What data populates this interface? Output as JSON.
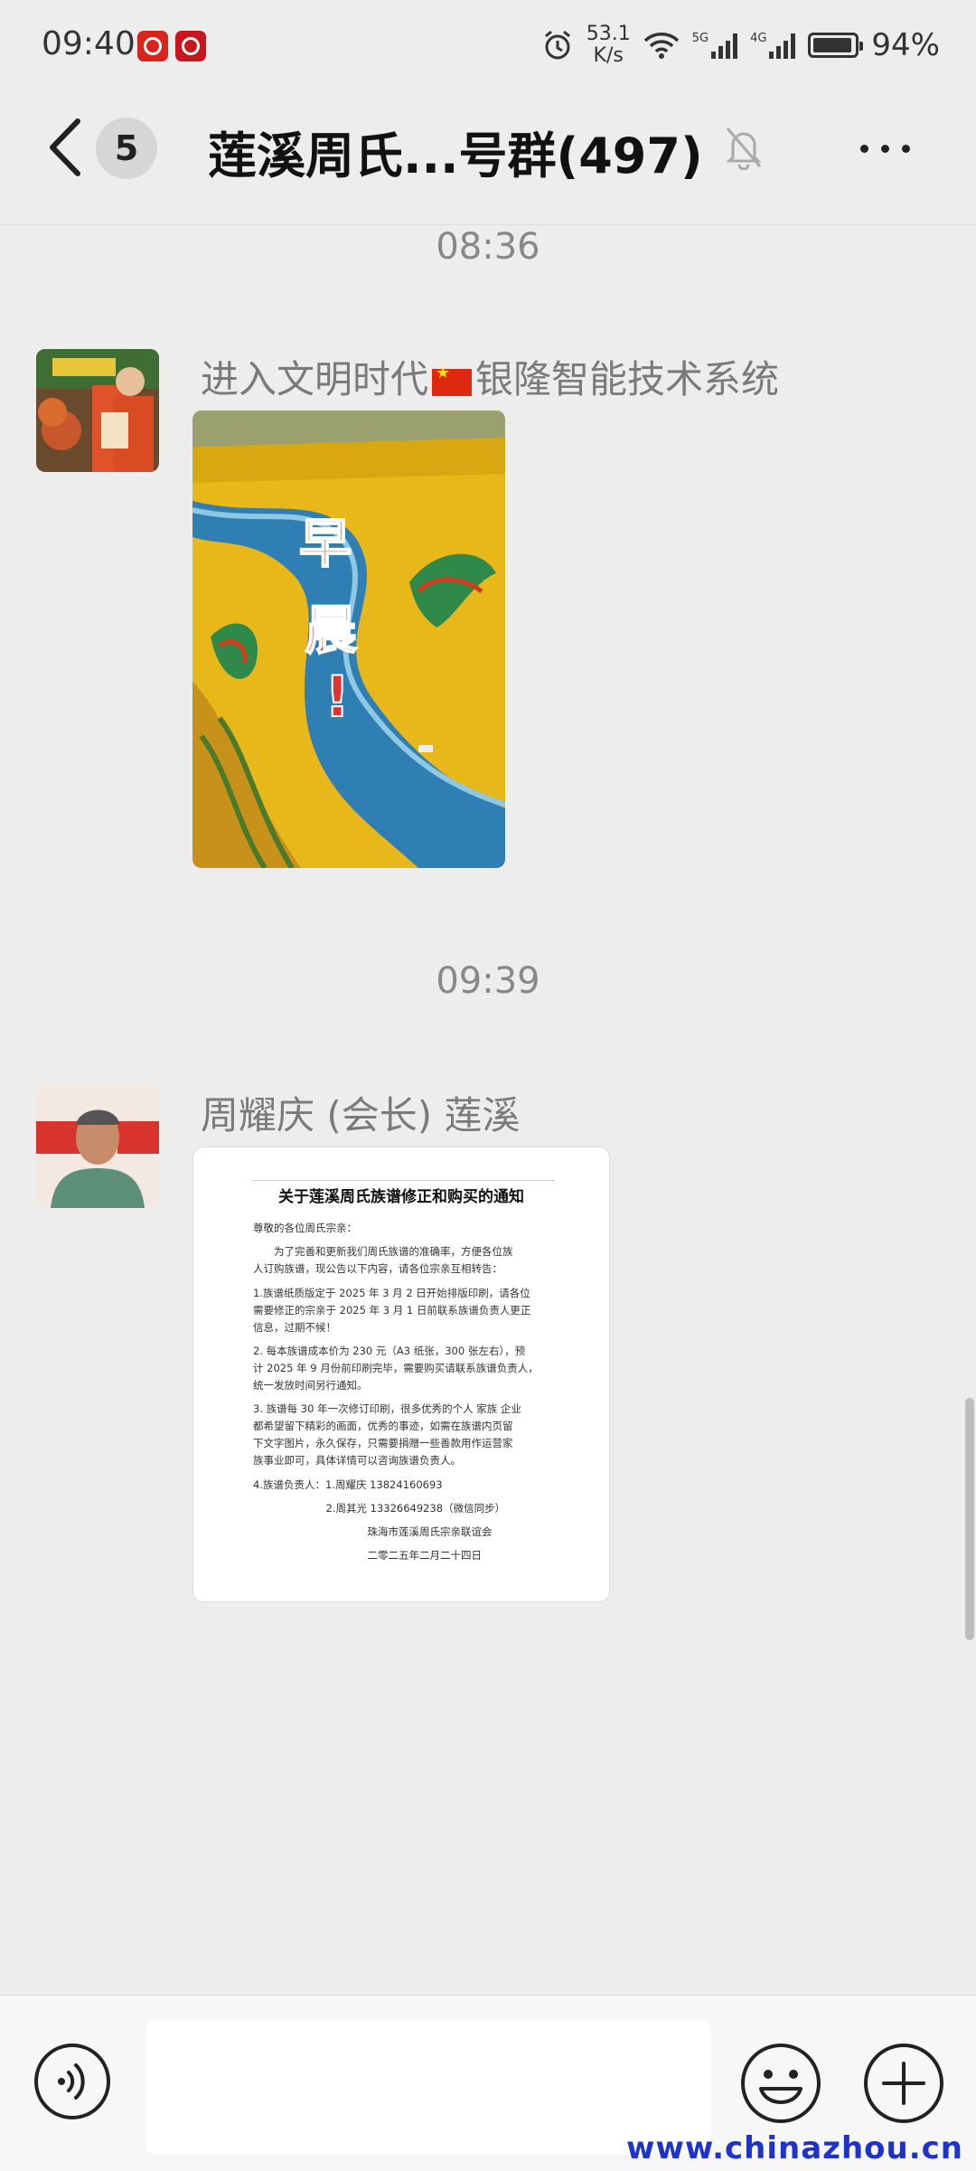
{
  "status_bar": {
    "time": "09:40",
    "net_speed_value": "53.1",
    "net_speed_unit": "K/s",
    "signal_1": "5G",
    "signal_2": "4G",
    "battery": "94%"
  },
  "header": {
    "unread_count": "5",
    "title": "莲溪周氏...号群(497)"
  },
  "messages": [
    {
      "time": "08:36",
      "sender_prefix": "进入文明时代",
      "sender_suffix": "银隆智能技术系统",
      "image_text": [
        "早",
        "晨",
        "!"
      ]
    },
    {
      "time": "09:39",
      "sender": "周耀庆 (会长) 莲溪",
      "document": {
        "title": "关于莲溪周氏族谱修正和购买的通知",
        "lines": [
          "尊敬的各位周氏宗亲：",
          "　　为了完善和更新我们周氏族谱的准确率，方便各位族",
          "人订购族谱，现公告以下内容，请各位宗亲互相转告：",
          "1.族谱纸质版定于 2025 年 3 月 2 日开始排版印刷，请各位",
          "需要修正的宗亲于 2025 年 3 月 1 日前联系族谱负责人更正",
          "信息，过期不候！",
          "2. 每本族谱成本价为 230 元（A3 纸张，300 张左右），预",
          "计 2025 年 9 月份前印刷完毕，需要购买请联系族谱负责人，",
          "统一发放时间另行通知。",
          "3. 族谱每 30 年一次修订印刷，很多优秀的个人 家族 企业",
          "都希望留下精彩的画面，优秀的事迹，如需在族谱内页留",
          "下文字图片，永久保存，只需要捐赠一些善款用作运营家",
          "族事业即可，具体详情可以咨询族谱负责人。",
          "4.族谱负责人：1.周耀庆 13824160693",
          "　　　　　　　2.周其光 13326649238（微信同步）",
          "　　　　　　　　　　　珠海市莲溪周氏宗亲联谊会",
          "　　　　　　　　　　　二零二五年二月二十四日"
        ]
      }
    }
  ],
  "watermark": "www.chinazhou.cn",
  "colors": {
    "background": "#ededed",
    "watermark": "#1e33c8",
    "flag_red": "#de2910"
  },
  "icons": [
    "back-icon",
    "bell-muted-icon",
    "more-icon",
    "voice-icon",
    "emoji-icon",
    "plus-icon",
    "china-flag-icon"
  ]
}
